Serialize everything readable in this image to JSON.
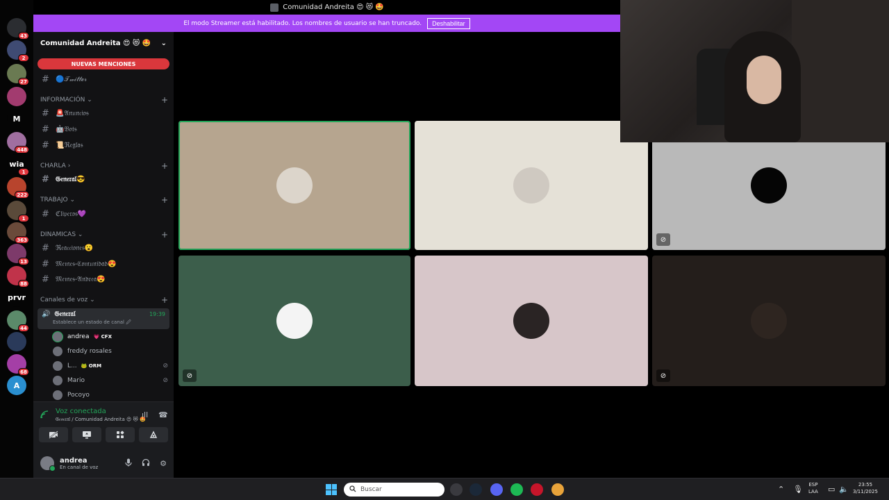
{
  "window": {
    "title": "Comunidad Andreita 😍 😻 🤩"
  },
  "streamer_banner": {
    "text": "El modo Streamer está habilitado. Los nombres de usuario se han truncado.",
    "button": "Deshabilitar"
  },
  "guilds": [
    {
      "name": "discord-home",
      "label": "",
      "badge": "43",
      "color": "#2b2d31"
    },
    {
      "name": "server-1",
      "label": "",
      "badge": "2",
      "color": "#3f4b73"
    },
    {
      "name": "server-2",
      "label": "",
      "badge": "27",
      "color": "#6a7a52"
    },
    {
      "name": "server-3",
      "label": "",
      "badge": "",
      "color": "#a23b6f"
    },
    {
      "name": "server-m",
      "label": "M",
      "badge": "",
      "color": "#050505"
    },
    {
      "name": "server-4",
      "label": "",
      "badge": "448",
      "color": "#a06fa0"
    },
    {
      "name": "server-wia",
      "label": "wia",
      "badge": "1",
      "color": "#050505"
    },
    {
      "name": "server-5",
      "label": "",
      "badge": "222",
      "color": "#b8442d"
    },
    {
      "name": "server-6",
      "label": "",
      "badge": "1",
      "color": "#5a4a3a"
    },
    {
      "name": "server-7",
      "label": "",
      "badge": "363",
      "color": "#6a4a3a"
    },
    {
      "name": "server-8",
      "label": "",
      "badge": "13",
      "color": "#7d3a6a"
    },
    {
      "name": "server-9",
      "label": "",
      "badge": "88",
      "color": "#c0334a"
    },
    {
      "name": "server-prvr",
      "label": "prvr",
      "badge": "",
      "color": "#050505"
    },
    {
      "name": "server-andreita",
      "label": "",
      "badge": "44",
      "color": "#5b8a6a"
    },
    {
      "name": "server-10",
      "label": "",
      "badge": "",
      "color": "#2a3a5a"
    },
    {
      "name": "server-11",
      "label": "",
      "badge": "68",
      "color": "#a43fa6"
    },
    {
      "name": "server-a",
      "label": "A",
      "badge": "",
      "color": "#2a8fd0"
    }
  ],
  "server": {
    "name": "Comunidad Andreita 😍 😻 🤩",
    "mentions": "NUEVAS MENCIONES"
  },
  "channels": {
    "twitter": "🔵𝒯𝓌𝒾𝓉𝓉ℯ𝓇",
    "cat_info": "INFORMACIÓN",
    "anuncios": "🚨𝔄𝔫𝔲𝔫𝔠𝔦𝔬𝔰",
    "bots": "🤖𝔅𝔬𝔱𝔰",
    "reglas": "📜ℜ𝔢𝔤𝔩𝔞𝔰",
    "cat_charla": "CHARLA",
    "general": "𝔊𝔢𝔫𝔢𝔯𝔞𝔩😎",
    "cat_trabajo": "TRABAJO",
    "clipero": "ℭ𝔩𝔦𝔭𝔢𝔯𝔬𝔰💜",
    "cat_dinamicas": "DINAMICAS",
    "reacciones": "ℜ𝔢𝔞𝔠𝔠𝔦𝔬𝔫𝔢𝔰😮",
    "memes_comunidad": "𝔐𝔢𝔪𝔢𝔰-ℭ𝔬𝔪𝔲𝔫𝔦𝔡𝔞𝔡😍",
    "memes_andrea": "𝔐𝔢𝔪𝔢𝔰-𝔄𝔫𝔡𝔯𝔢𝔞😍",
    "cat_voz": "Canales de voz",
    "voice_general": "𝔊𝔢𝔫𝔢𝔯𝔞𝔩",
    "voice_time": "19:39",
    "voice_status": "Establece un estado de canal 🖉"
  },
  "voice_users": [
    {
      "name": "andrea",
      "tag": "💗 CFX",
      "muted": false
    },
    {
      "name": "freddy rosales",
      "tag": "",
      "muted": false
    },
    {
      "name": "L...",
      "tag": "🐸 ORM",
      "muted": true
    },
    {
      "name": "Mario",
      "tag": "",
      "muted": true
    },
    {
      "name": "Pocoyo",
      "tag": "",
      "muted": false
    }
  ],
  "voice_panel": {
    "title": "Voz conectada",
    "sub": "𝔊𝔢𝔫𝔢𝔯𝔞𝔩 / Comunidad Andreita 😍 😻 🤩"
  },
  "user": {
    "name": "andrea",
    "status": "En canal de voz"
  },
  "icons": {
    "hash": "#",
    "plus": "+",
    "chevron": "⌄",
    "speaker": "🔊",
    "mute": "🎙̸",
    "signal": "📶",
    "waveform": "ıll",
    "hangup": "☎",
    "cam_off": "⊘",
    "screen": "🖥",
    "activity": "✦",
    "sound": "⚡",
    "mic": "🎙",
    "headset": "🎧",
    "gear": "⚙",
    "search": "⌕"
  },
  "taskbar": {
    "search": "Buscar",
    "lang": "ESP",
    "layout": "LAA",
    "time": "23:55",
    "date": "3/11/2025"
  },
  "colors": {
    "accent": "#a347f5",
    "online": "#23a559",
    "danger": "#da373c"
  }
}
